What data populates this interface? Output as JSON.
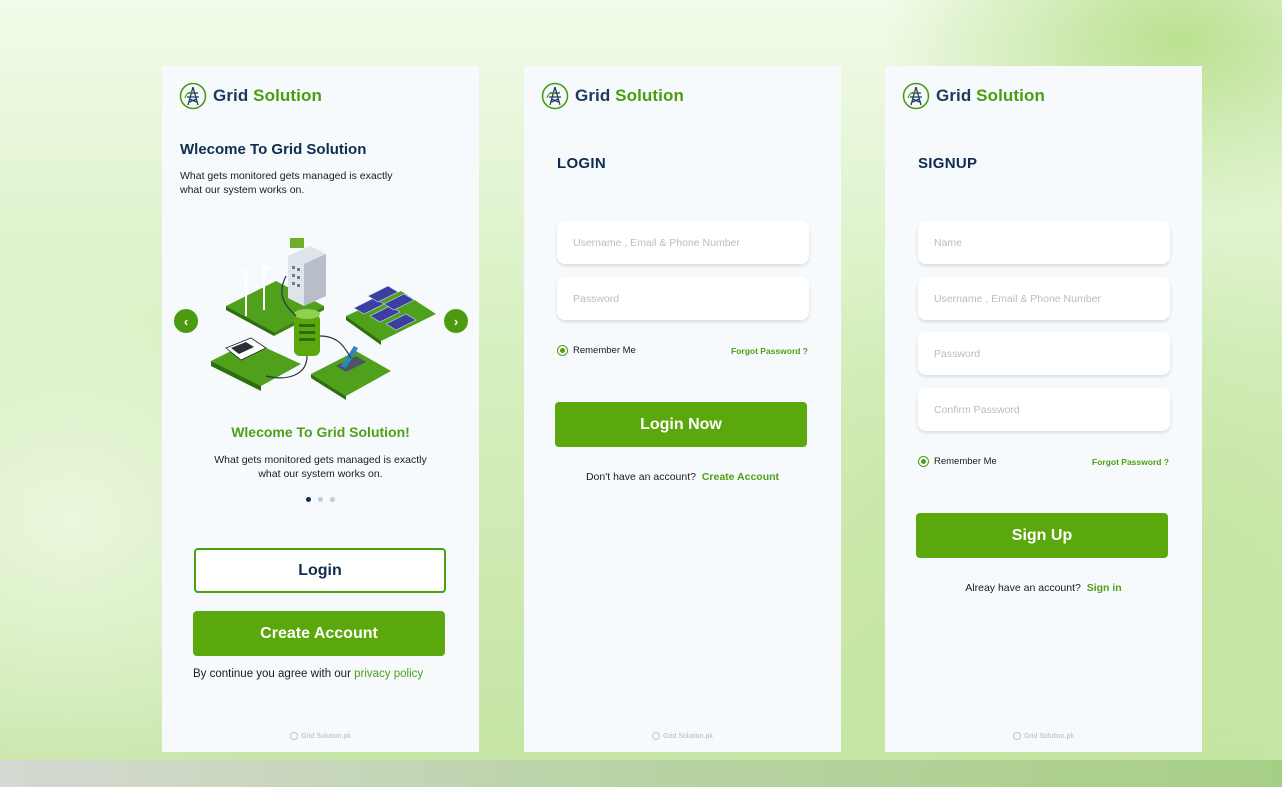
{
  "brand": {
    "name_part1": "Grid ",
    "name_part2": "Solution",
    "logo_icon": "transmission-tower-icon"
  },
  "colors": {
    "accent_green": "#5aa80b",
    "navy": "#0f2d4f",
    "card_bg": "#f6fafc"
  },
  "welcome": {
    "heading": "Wlecome To Grid Solution",
    "description": "What gets monitored gets managed is exactly what our system works on.",
    "carousel": {
      "prev_icon": "chevron-left-icon",
      "next_icon": "chevron-right-icon",
      "slide_title": "Wlecome To Grid Solution!",
      "slide_text": "What gets monitored gets managed is exactly what our system works on.",
      "total_slides": 3,
      "active_slide": 1
    },
    "login_button": "Login",
    "create_account_button": "Create Account",
    "agree_text": "By continue you agree with our ",
    "privacy_link": "privacy policy"
  },
  "login": {
    "title": "LOGIN",
    "username_placeholder": "Username , Email & Phone Number",
    "password_placeholder": "Password",
    "remember_me": "Remember Me",
    "forgot_password": "Forgot Password ?",
    "submit_button": "Login Now",
    "no_account_text": "Don't have an account?",
    "create_account_link": "Create Account"
  },
  "signup": {
    "title": "SIGNUP",
    "name_placeholder": "Name",
    "username_placeholder": "Username , Email & Phone Number",
    "password_placeholder": "Password",
    "confirm_password_placeholder": "Confirm Password",
    "remember_me": "Remember Me",
    "forgot_password": "Forgot Password ?",
    "submit_button": "Sign Up",
    "have_account_text": "Alreay have an account?",
    "signin_link": "Sign in"
  },
  "footer": {
    "text": "Grid Solution.pk"
  }
}
